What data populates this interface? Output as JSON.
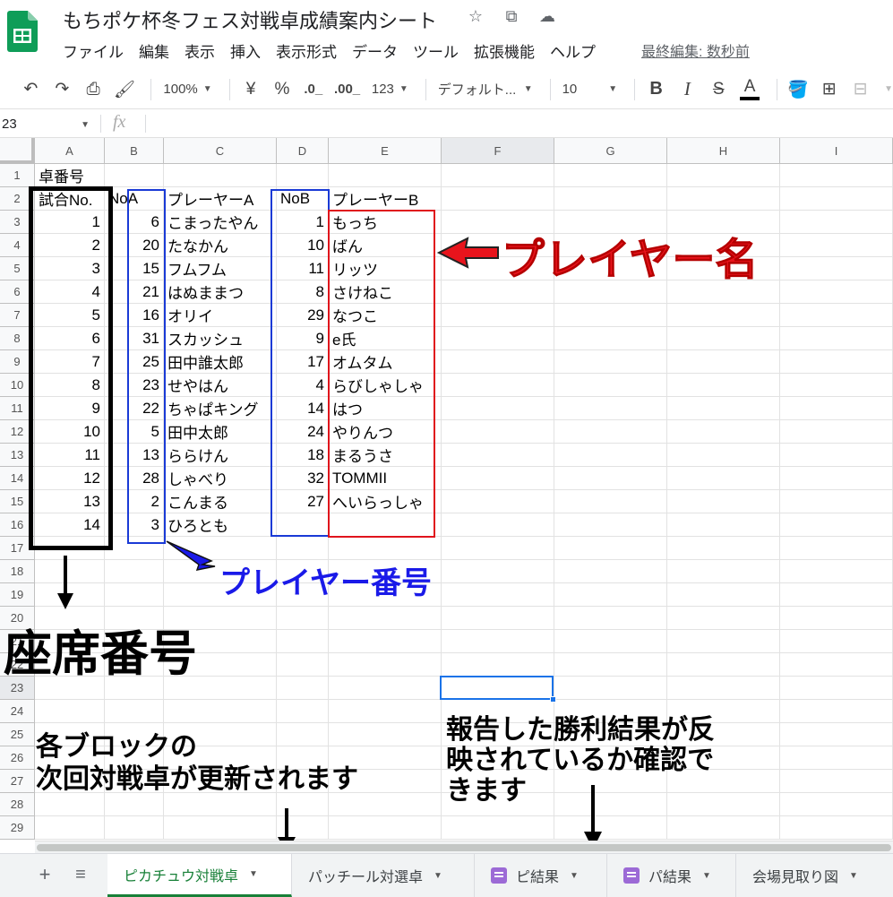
{
  "doc": {
    "title": "もちポケ杯冬フェス対戦卓成績案内シート",
    "last_edit": "最終編集: 数秒前"
  },
  "menu": [
    "ファイル",
    "編集",
    "表示",
    "挿入",
    "表示形式",
    "データ",
    "ツール",
    "拡張機能",
    "ヘルプ"
  ],
  "toolbar": {
    "zoom": "100%",
    "currency": "¥",
    "percent": "%",
    "dec_decrease": ".0_",
    "dec_increase": ".00_",
    "format_num": "123",
    "font": "デフォルト...",
    "font_size": "10",
    "bold": "B",
    "italic": "I",
    "strike": "S",
    "text_color": "A"
  },
  "formula": {
    "name_box": "23",
    "fx": "fx"
  },
  "grid": {
    "columns": [
      "A",
      "B",
      "C",
      "D",
      "E",
      "F",
      "G",
      "H",
      "I"
    ],
    "rows": [
      "1",
      "2",
      "3",
      "4",
      "5",
      "6",
      "7",
      "8",
      "9",
      "10",
      "11",
      "12",
      "13",
      "14",
      "15",
      "16",
      "17",
      "18",
      "19",
      "20",
      "21",
      "22",
      "23",
      "24",
      "25",
      "26",
      "27",
      "28",
      "29"
    ],
    "a1": "卓番号",
    "headers": {
      "a": "試合No.",
      "b": "NoA",
      "c": "プレーヤーA",
      "d": "NoB",
      "e": "プレーヤーB"
    },
    "data": [
      {
        "match": "1",
        "noa": "6",
        "pa": "こまったやん",
        "nob": "1",
        "pb": "もっち"
      },
      {
        "match": "2",
        "noa": "20",
        "pa": "たなかん",
        "nob": "10",
        "pb": "ばん"
      },
      {
        "match": "3",
        "noa": "15",
        "pa": "フムフム",
        "nob": "11",
        "pb": "リッツ"
      },
      {
        "match": "4",
        "noa": "21",
        "pa": "はぬままつ",
        "nob": "8",
        "pb": "さけねこ"
      },
      {
        "match": "5",
        "noa": "16",
        "pa": "オリイ",
        "nob": "29",
        "pb": "なつこ"
      },
      {
        "match": "6",
        "noa": "31",
        "pa": "スカッシュ",
        "nob": "9",
        "pb": "e氏"
      },
      {
        "match": "7",
        "noa": "25",
        "pa": "田中誰太郎",
        "nob": "17",
        "pb": "オムタム"
      },
      {
        "match": "8",
        "noa": "23",
        "pa": "せやはん",
        "nob": "4",
        "pb": "らびしゃしゃ"
      },
      {
        "match": "9",
        "noa": "22",
        "pa": "ちゃぱキング",
        "nob": "14",
        "pb": "はつ"
      },
      {
        "match": "10",
        "noa": "5",
        "pa": "田中太郎",
        "nob": "24",
        "pb": "やりんつ"
      },
      {
        "match": "11",
        "noa": "13",
        "pa": "ららけん",
        "nob": "18",
        "pb": "まるうさ"
      },
      {
        "match": "12",
        "noa": "28",
        "pa": "しゃべり",
        "nob": "32",
        "pb": "TOMMII"
      },
      {
        "match": "13",
        "noa": "2",
        "pa": "こんまる",
        "nob": "27",
        "pb": "へいらっしゃ"
      },
      {
        "match": "14",
        "noa": "3",
        "pa": "ひろとも",
        "nob": "",
        "pb": ""
      }
    ]
  },
  "annotations": {
    "player_name": "プレイヤー名",
    "player_number": "プレイヤー番号",
    "seat_number": "座席番号",
    "left_line1": "各ブロックの",
    "left_line2": "次回対戦卓が更新されます",
    "right_line1": "報告した勝利結果が反",
    "right_line2": "映されているか確認で",
    "right_line3": "きます"
  },
  "tabs": [
    {
      "label": "ピカチュウ対戦卓",
      "active": true
    },
    {
      "label": "パッチール対選卓",
      "active": false
    },
    {
      "label": "ピ結果",
      "active": false
    },
    {
      "label": "パ結果",
      "active": false
    },
    {
      "label": "会場見取り図",
      "active": false
    }
  ],
  "colors": {
    "accent_green": "#188038",
    "red": "#e8141c",
    "blue": "#1a1ae8",
    "select_blue": "#1a73e8"
  }
}
